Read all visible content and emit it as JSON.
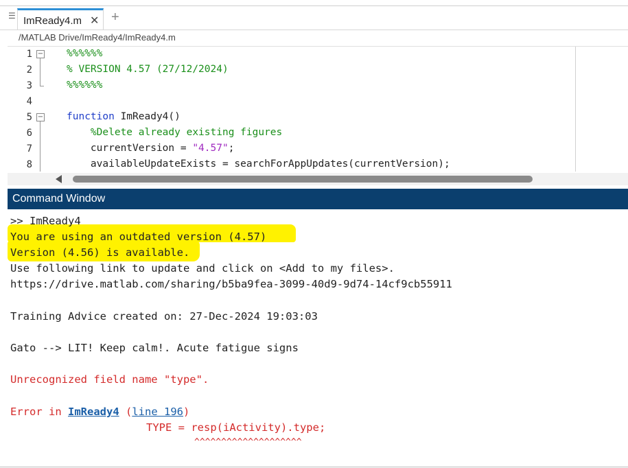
{
  "tabs": [
    {
      "label": "ImReady4.m",
      "active": true
    }
  ],
  "filepath": "/MATLAB Drive/ImReady4/ImReady4.m",
  "editor": {
    "lines": [
      {
        "n": "1",
        "text": "%%%%%%",
        "kind": "comment"
      },
      {
        "n": "2",
        "text": "% VERSION 4.57 (27/12/2024)",
        "kind": "comment"
      },
      {
        "n": "3",
        "text": "%%%%%%",
        "kind": "comment"
      },
      {
        "n": "4",
        "text": "",
        "kind": "plain"
      },
      {
        "n": "5",
        "kw": "function",
        "rest": " ImReady4()"
      },
      {
        "n": "6",
        "text": "    %Delete already existing figures",
        "kind": "comment"
      },
      {
        "n": "7",
        "pre": "    currentVersion = ",
        "str": "\"4.57\"",
        "post": ";"
      },
      {
        "n": "8",
        "text": "    availableUpdateExists = searchForAppUpdates(currentVersion);",
        "kind": "plain"
      }
    ]
  },
  "command_window": {
    "title": "Command Window",
    "output": [
      ">> ImReady4",
      "You are using an outdated version (4.57)",
      "Version (4.56) is available.",
      "Use following link to update and click on <Add to my files>.",
      "https://drive.matlab.com/sharing/b5ba9fea-3099-40d9-9d74-14cf9cb55911",
      "Training Advice created on: 27-Dec-2024 19:03:03",
      "Gato --> LIT! Keep calm!. Acute fatigue signs",
      "Unrecognized field name \"type\"."
    ],
    "error": {
      "prefix": "Error in ",
      "func": "ImReady4",
      "open": " (",
      "line_link": "line 196",
      "close": ")",
      "code": "TYPE = resp(iActivity).type;",
      "carets": "^^^^^^^^^^^^^^^^^^^^"
    }
  },
  "colors": {
    "header_bg": "#0b3f6e",
    "highlight": "#fff200",
    "comment": "#1a8f1a",
    "keyword": "#1f3ec9",
    "string": "#a02bc0",
    "error": "#d42b2b",
    "link": "#1b5fa8"
  },
  "icons": [
    "menu-icon",
    "close-icon",
    "add-tab-icon",
    "fold-icon",
    "scroll-left-icon"
  ]
}
